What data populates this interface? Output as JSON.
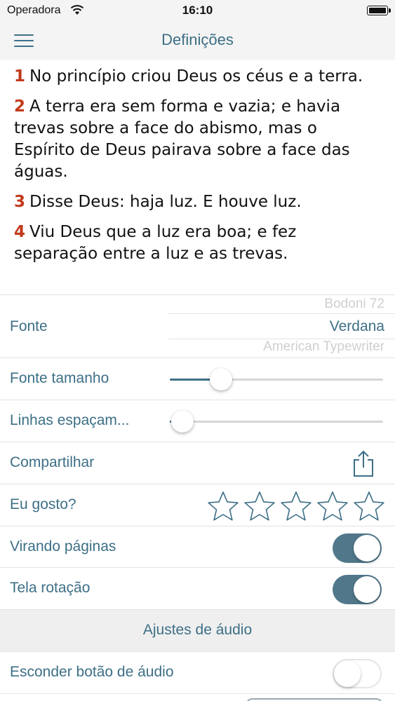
{
  "status_bar": {
    "carrier": "Operadora",
    "time": "16:10",
    "wifi_icon": "wifi-icon",
    "battery_icon": "battery-icon"
  },
  "nav": {
    "title": "Definições",
    "menu_icon": "hamburger-menu-icon"
  },
  "preview": {
    "verses": [
      {
        "num": "1",
        "text": "No princípio criou Deus os céus e a terra."
      },
      {
        "num": "2",
        "text": "A terra era sem forma e vazia; e havia trevas sobre a face do abismo, mas o Espírito de Deus pairava sobre a face das águas."
      },
      {
        "num": "3",
        "text": "Disse Deus: haja luz. E houve luz."
      },
      {
        "num": "4",
        "text": "Viu Deus que a luz era boa; e fez separação entre a luz e as trevas."
      }
    ]
  },
  "settings": {
    "font": {
      "label": "Fonte",
      "options": [
        "Bodoni 72",
        "Verdana",
        "American Typewriter"
      ],
      "selected": "Verdana"
    },
    "font_size": {
      "label": "Fonte tamanho",
      "value_fraction": 0.24
    },
    "line_spacing": {
      "label": "Linhas espaçam...",
      "value_fraction": 0.06
    },
    "share": {
      "label": "Compartilhar",
      "icon": "share-icon"
    },
    "like": {
      "label": "Eu gosto?",
      "rating": 0,
      "max": 5,
      "icon": "star-outline-icon"
    },
    "page_flip": {
      "label": "Virando páginas",
      "on": true
    },
    "rotation": {
      "label": "Tela rotação",
      "on": true
    }
  },
  "audio_section": {
    "header": "Ajustes de áudio",
    "hide_audio_button": {
      "label": "Esconder botão de áudio",
      "on": false
    }
  },
  "colors": {
    "accent": "#3d6f86",
    "verse_number": "#c2391b",
    "toggle_on": "#51788a",
    "bar_background": "#f4f4f4"
  }
}
